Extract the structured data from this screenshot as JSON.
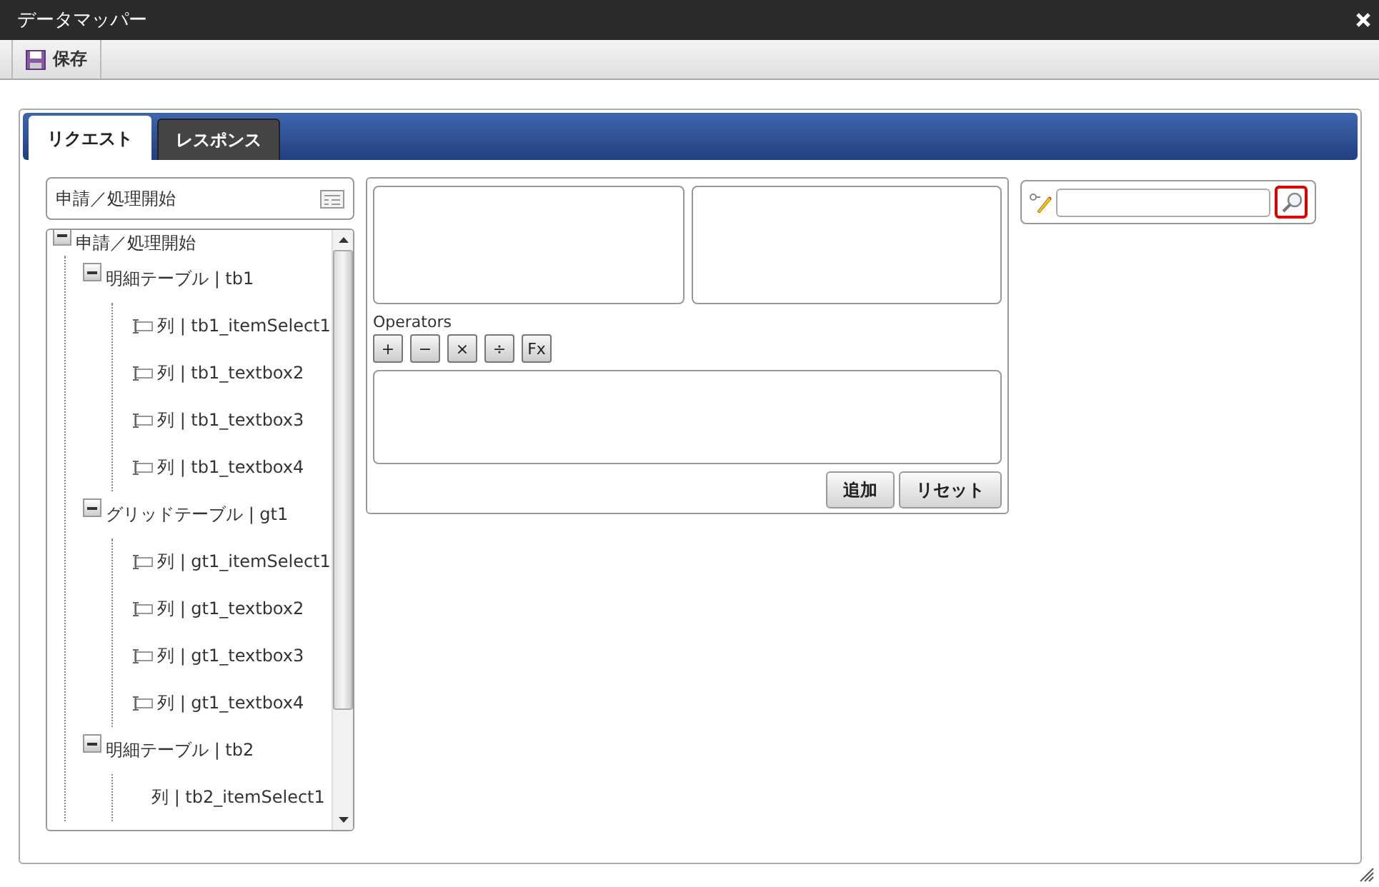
{
  "window": {
    "title": "データマッパー"
  },
  "toolbar": {
    "buttons": [
      "保存"
    ]
  },
  "tabs": [
    {
      "label": "リクエスト",
      "selected": true
    },
    {
      "label": "レスポンス",
      "selected": false
    }
  ],
  "source_header": {
    "title": "申請／処理開始"
  },
  "tree": [
    {
      "label": "申請／処理開始",
      "expanded": true,
      "children": [
        {
          "label": "明細テーブル | tb1",
          "expanded": true,
          "children": [
            {
              "label": "列 | tb1_itemSelect1",
              "icon": true
            },
            {
              "label": "列 | tb1_textbox2",
              "icon": true
            },
            {
              "label": "列 | tb1_textbox3",
              "icon": true
            },
            {
              "label": "列 | tb1_textbox4",
              "icon": true
            }
          ]
        },
        {
          "label": "グリッドテーブル | gt1",
          "expanded": true,
          "children": [
            {
              "label": "列 | gt1_itemSelect1",
              "icon": true
            },
            {
              "label": "列 | gt1_textbox2",
              "icon": true
            },
            {
              "label": "列 | gt1_textbox3",
              "icon": true
            },
            {
              "label": "列 | gt1_textbox4",
              "icon": true
            }
          ]
        },
        {
          "label": "明細テーブル | tb2",
          "expanded": true,
          "children": [
            {
              "label": "列 | tb2_itemSelect1",
              "icon": false
            }
          ]
        }
      ]
    }
  ],
  "editor": {
    "operators_label": "Operators",
    "operators": [
      "+",
      "−",
      "×",
      "÷",
      "Fx"
    ],
    "buttons": [
      "追加",
      "リセット"
    ]
  }
}
